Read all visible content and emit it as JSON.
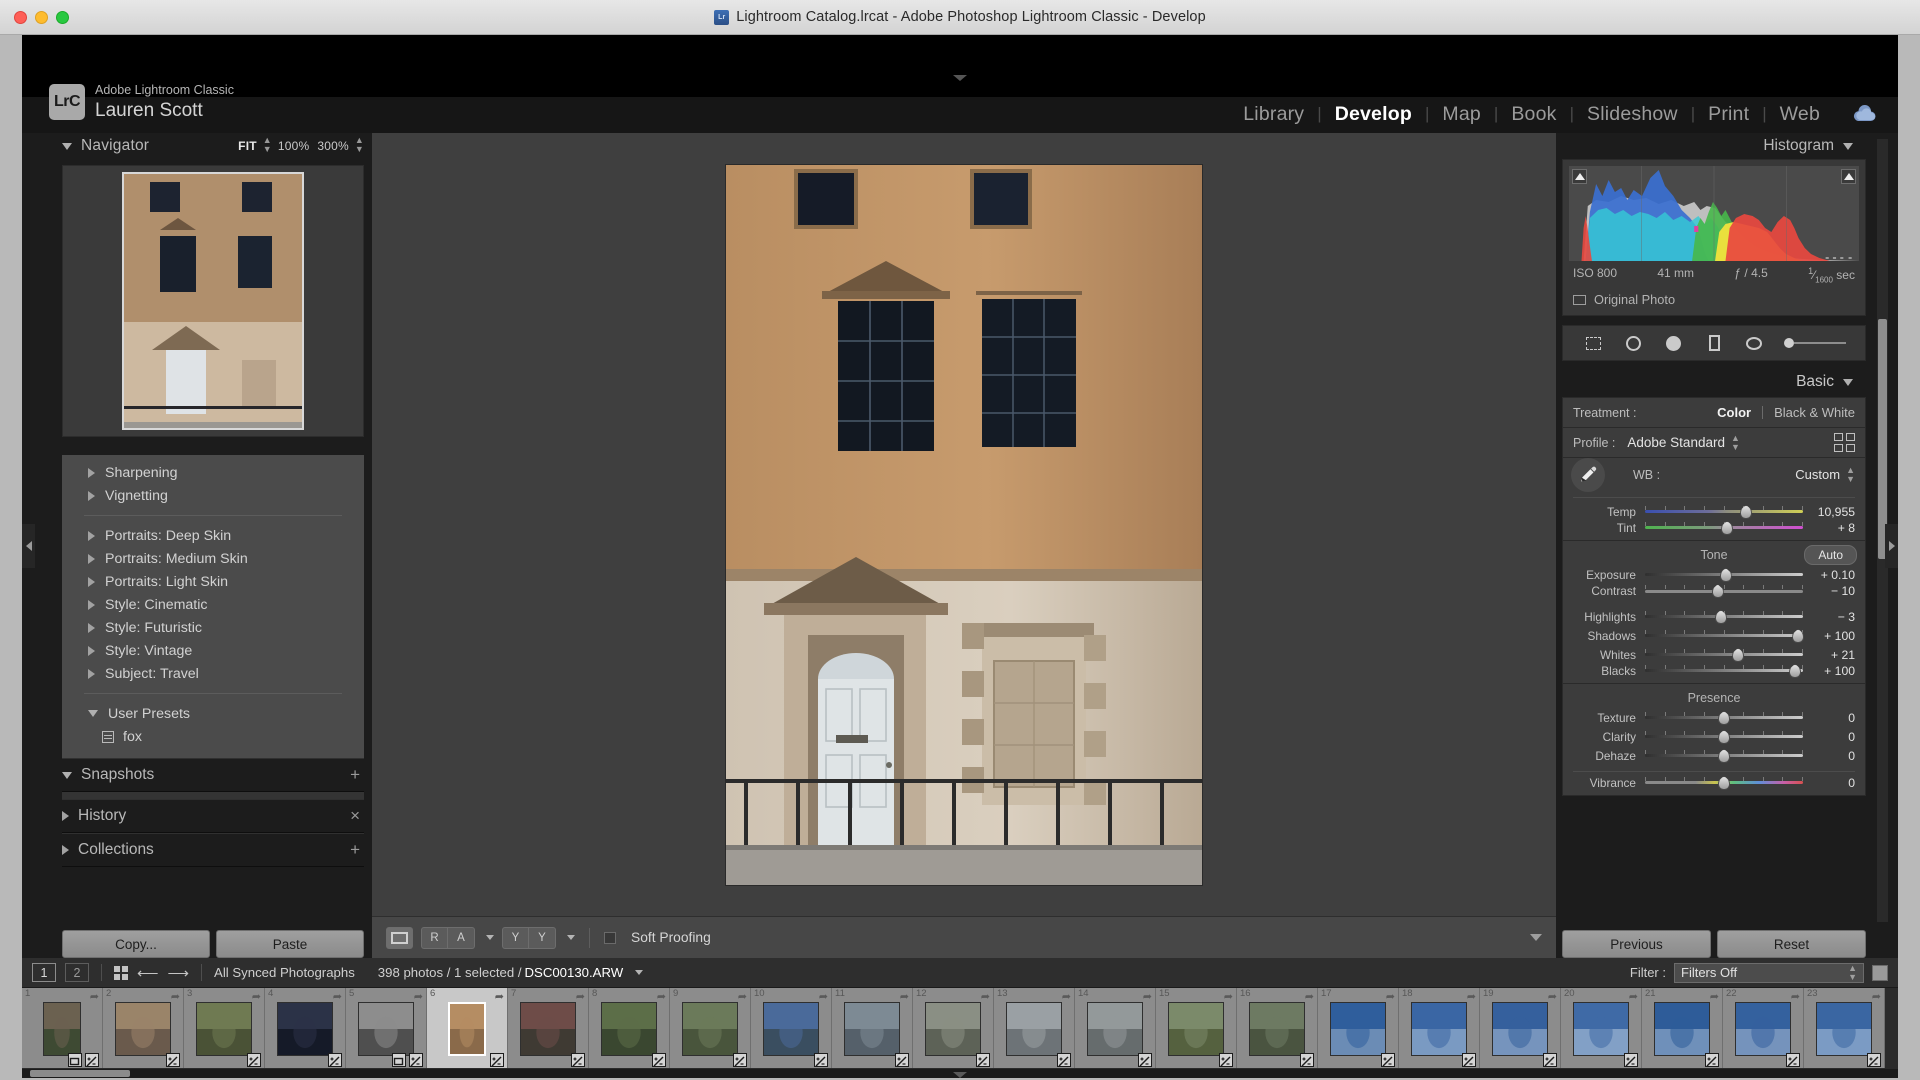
{
  "window": {
    "title": "Lightroom Catalog.lrcat - Adobe Photoshop Lightroom Classic - Develop",
    "app_icon": "lrc-icon"
  },
  "identity": {
    "logo": "LrC",
    "app_name": "Adobe Lightroom Classic",
    "user_name": "Lauren Scott"
  },
  "modules": [
    {
      "label": "Library",
      "active": false
    },
    {
      "label": "Develop",
      "active": true
    },
    {
      "label": "Map",
      "active": false
    },
    {
      "label": "Book",
      "active": false
    },
    {
      "label": "Slideshow",
      "active": false
    },
    {
      "label": "Print",
      "active": false
    },
    {
      "label": "Web",
      "active": false
    }
  ],
  "left_panel": {
    "navigator": {
      "title": "Navigator",
      "zoom_levels": [
        {
          "label": "FIT",
          "active": true
        },
        {
          "label": "100%",
          "active": false
        },
        {
          "label": "300%",
          "active": false
        }
      ]
    },
    "presets": {
      "groups_top": [
        {
          "label": "Sharpening",
          "expanded": false
        },
        {
          "label": "Vignetting",
          "expanded": false
        }
      ],
      "groups_mid": [
        {
          "label": "Portraits: Deep Skin",
          "expanded": false
        },
        {
          "label": "Portraits: Medium Skin",
          "expanded": false
        },
        {
          "label": "Portraits: Light Skin",
          "expanded": false
        },
        {
          "label": "Style: Cinematic",
          "expanded": false
        },
        {
          "label": "Style: Futuristic",
          "expanded": false
        },
        {
          "label": "Style: Vintage",
          "expanded": false
        },
        {
          "label": "Subject: Travel",
          "expanded": false
        }
      ],
      "user_presets": {
        "label": "User Presets",
        "expanded": true,
        "items": [
          {
            "label": "fox"
          }
        ]
      }
    },
    "sections": [
      {
        "label": "Snapshots",
        "expanded": true,
        "action": "+"
      },
      {
        "label": "History",
        "expanded": false,
        "action": "×"
      },
      {
        "label": "Collections",
        "expanded": false,
        "action": "+"
      }
    ],
    "buttons": {
      "copy": "Copy...",
      "paste": "Paste"
    }
  },
  "toolbar": {
    "loupe_label": "Loupe view",
    "before_after_ra": [
      "R",
      "A"
    ],
    "before_after_yy": [
      "Y",
      "Y"
    ],
    "soft_proofing_label": "Soft Proofing",
    "soft_proofing_checked": false
  },
  "right_panel": {
    "histogram": {
      "title": "Histogram",
      "iso": "ISO 800",
      "focal": "41 mm",
      "aperture": "ƒ / 4.5",
      "shutter_num": "1",
      "shutter_den": "1600",
      "shutter_unit": "sec",
      "original_photo_label": "Original Photo"
    },
    "tools": [
      "crop-overlay-icon",
      "spot-removal-icon",
      "red-eye-icon",
      "graduated-filter-icon",
      "radial-filter-icon",
      "adjustment-brush-icon"
    ],
    "basic": {
      "title": "Basic",
      "treatment_label": "Treatment :",
      "treatment_options": [
        {
          "label": "Color",
          "active": true
        },
        {
          "label": "Black & White",
          "active": false
        }
      ],
      "profile_label": "Profile :",
      "profile_value": "Adobe Standard",
      "wb_label": "WB :",
      "wb_value": "Custom",
      "white_balance_sliders": [
        {
          "name": "Temp",
          "value": "10,955",
          "pos": 64
        },
        {
          "name": "Tint",
          "value": "+ 8",
          "pos": 52
        }
      ],
      "tone_label": "Tone",
      "auto_label": "Auto",
      "tone_sliders": [
        {
          "name": "Exposure",
          "value": "+ 0.10",
          "pos": 51
        },
        {
          "name": "Contrast",
          "value": "− 10",
          "pos": 46
        },
        {
          "name": "Highlights",
          "value": "− 3",
          "pos": 48
        },
        {
          "name": "Shadows",
          "value": "+ 100",
          "pos": 97
        },
        {
          "name": "Whites",
          "value": "+ 21",
          "pos": 59
        },
        {
          "name": "Blacks",
          "value": "+ 100",
          "pos": 95
        }
      ],
      "presence_label": "Presence",
      "presence_sliders": [
        {
          "name": "Texture",
          "value": "0",
          "pos": 50
        },
        {
          "name": "Clarity",
          "value": "0",
          "pos": 50
        },
        {
          "name": "Dehaze",
          "value": "0",
          "pos": 50
        }
      ],
      "vibrance_slider": {
        "name": "Vibrance",
        "value": "0",
        "pos": 50
      }
    },
    "buttons": {
      "previous": "Previous",
      "reset": "Reset"
    }
  },
  "filmstrip_bar": {
    "page_buttons": [
      "1",
      "2"
    ],
    "source_label": "All Synced Photographs",
    "count_text": "398 photos / 1 selected / ",
    "filename": "DSC00130.ARW",
    "filter_label": "Filter :",
    "filter_value": "Filters Off"
  },
  "filmstrip": {
    "selected_index": 6,
    "thumbs": [
      {
        "num": "1",
        "c1": "#6b6150",
        "c2": "#3e4a33",
        "badges": [
          "crop",
          "edit"
        ]
      },
      {
        "num": "2",
        "c1": "#9a8469",
        "c2": "#6a5a4c",
        "badges": [
          "edit"
        ]
      },
      {
        "num": "3",
        "c1": "#6f7a52",
        "c2": "#4a5236",
        "badges": [
          "edit"
        ]
      },
      {
        "num": "4",
        "c1": "#2b3247",
        "c2": "#151a28",
        "badges": [
          "edit"
        ]
      },
      {
        "num": "5",
        "c1": "#8d8d8d",
        "c2": "#4f4f4f",
        "badges": [
          "crop",
          "edit"
        ]
      },
      {
        "num": "6",
        "c1": "#b58d63",
        "c2": "#8a6a4a",
        "badges": [
          "edit"
        ]
      },
      {
        "num": "7",
        "c1": "#6e4c48",
        "c2": "#3f3a33",
        "badges": [
          "edit"
        ]
      },
      {
        "num": "8",
        "c1": "#5c6e48",
        "c2": "#3a4730",
        "badges": [
          "edit"
        ]
      },
      {
        "num": "9",
        "c1": "#6b7a5a",
        "c2": "#49553c",
        "badges": [
          "edit"
        ]
      },
      {
        "num": "10",
        "c1": "#4a6a9a",
        "c2": "#3a4e60",
        "badges": [
          "edit"
        ]
      },
      {
        "num": "11",
        "c1": "#7d8a94",
        "c2": "#55606a",
        "badges": [
          "edit"
        ]
      },
      {
        "num": "12",
        "c1": "#8a8f84",
        "c2": "#5d6257",
        "badges": [
          "edit"
        ]
      },
      {
        "num": "13",
        "c1": "#9aa0a4",
        "c2": "#6d7377",
        "badges": [
          "edit"
        ]
      },
      {
        "num": "14",
        "c1": "#93999a",
        "c2": "#666c6d",
        "badges": [
          "edit"
        ]
      },
      {
        "num": "15",
        "c1": "#7b8a6a",
        "c2": "#55613f",
        "badges": [
          "edit"
        ]
      },
      {
        "num": "16",
        "c1": "#6d7a62",
        "c2": "#4a5440",
        "badges": [
          "edit"
        ]
      },
      {
        "num": "17",
        "c1": "#2f5e9c",
        "c2": "#6b8cb5",
        "badges": [
          "edit"
        ]
      },
      {
        "num": "18",
        "c1": "#3a66a4",
        "c2": "#7a9ac2",
        "badges": [
          "edit"
        ]
      },
      {
        "num": "19",
        "c1": "#35609d",
        "c2": "#7694bd",
        "badges": [
          "edit"
        ]
      },
      {
        "num": "20",
        "c1": "#3f6aa6",
        "c2": "#82a0c6",
        "badges": [
          "edit"
        ]
      },
      {
        "num": "21",
        "c1": "#2e5c99",
        "c2": "#6f90ba",
        "badges": [
          "edit"
        ]
      },
      {
        "num": "22",
        "c1": "#34619e",
        "c2": "#7593bc",
        "badges": [
          "edit"
        ]
      },
      {
        "num": "23",
        "c1": "#3a66a2",
        "c2": "#7b9bc4",
        "badges": [
          "edit"
        ]
      }
    ]
  },
  "colors": {
    "panel_bg": "#1c1c1c",
    "card_bg": "#3c3c3c",
    "center_bg": "#3f3f3f",
    "accent_text": "#ffffff"
  }
}
